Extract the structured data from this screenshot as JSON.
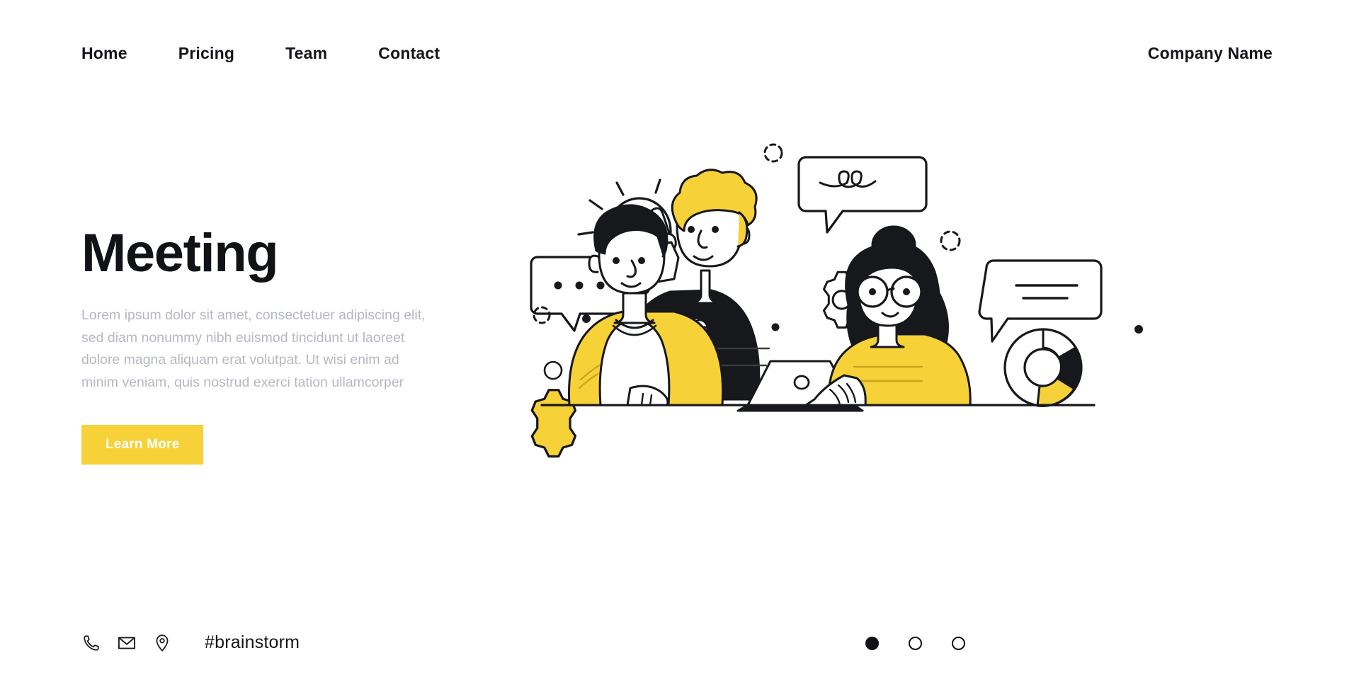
{
  "header": {
    "nav": [
      {
        "label": "Home"
      },
      {
        "label": "Pricing"
      },
      {
        "label": "Team"
      },
      {
        "label": "Contact"
      }
    ],
    "brand": "Company Name"
  },
  "hero": {
    "title": "Meeting",
    "body": "Lorem ipsum dolor sit amet, consectetuer adipiscing elit, sed diam nonummy nibh euismod tincidunt ut laoreet dolore magna aliquam erat volutpat. Ut wisi enim ad minim veniam, quis nostrud exerci tation ullamcorper",
    "cta_label": "Learn More"
  },
  "footer": {
    "icons": [
      {
        "name": "phone-icon"
      },
      {
        "name": "envelope-icon"
      },
      {
        "name": "location-pin-icon"
      }
    ],
    "hashtag": "#brainstorm"
  },
  "carousel": {
    "dots": [
      {
        "active": true
      },
      {
        "active": false
      },
      {
        "active": false
      }
    ]
  },
  "illustration": {
    "alt": "Three people in a meeting with lightbulb, speech bubbles, gears and chart",
    "elements": [
      "lightbulb-icon",
      "speech-bubble-dots",
      "speech-bubble-scribble",
      "speech-bubble-lines",
      "gear-icon-yellow",
      "gear-icon-outline",
      "donut-chart",
      "person-left-yellow-jacket",
      "person-center-yellow-hair",
      "person-right-glasses",
      "laptop"
    ]
  },
  "colors": {
    "accent_yellow": "#F7D138",
    "ink": "#111216",
    "muted_text": "#B6B9C0",
    "background": "#FFFFFF"
  }
}
